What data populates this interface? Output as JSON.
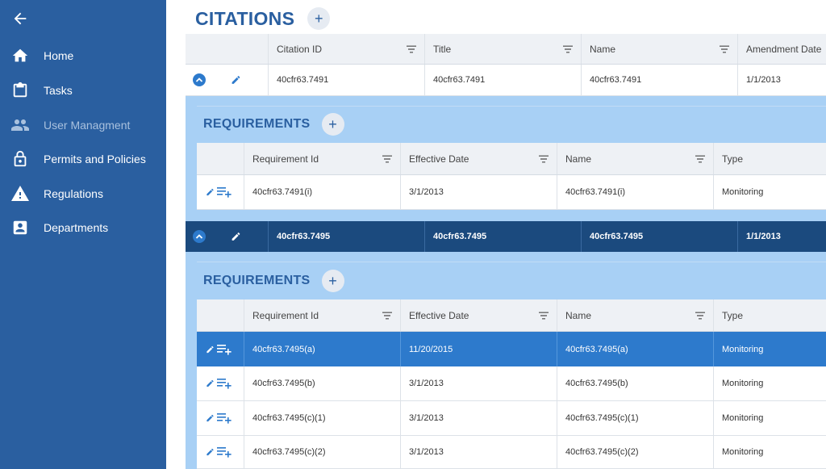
{
  "sidebar": {
    "items": [
      {
        "label": "Home",
        "icon": "home-icon"
      },
      {
        "label": "Tasks",
        "icon": "clipboard-icon"
      },
      {
        "label": "User Managment",
        "icon": "people-icon",
        "disabled": true
      },
      {
        "label": "Permits and Policies",
        "icon": "lock-icon"
      },
      {
        "label": "Regulations",
        "icon": "warning-icon"
      },
      {
        "label": "Departments",
        "icon": "contact-card-icon"
      }
    ]
  },
  "citations": {
    "title": "CITATIONS",
    "add_label": "+",
    "columns": [
      "Citation ID",
      "Title",
      "Name",
      "Amendment Date"
    ],
    "rows": [
      {
        "citation_id": "40cfr63.7491",
        "title": "40cfr63.7491",
        "name": "40cfr63.7491",
        "amendment_date": "1/1/2013"
      },
      {
        "citation_id": "40cfr63.7495",
        "title": "40cfr63.7495",
        "name": "40cfr63.7495",
        "amendment_date": "1/1/2013"
      }
    ]
  },
  "requirements": {
    "title": "REQUIREMENTS",
    "add_label": "+",
    "columns": [
      "Requirement Id",
      "Effective Date",
      "Name",
      "Type"
    ],
    "groups": [
      {
        "rows": [
          {
            "id": "40cfr63.7491(i)",
            "effective_date": "3/1/2013",
            "name": "40cfr63.7491(i)",
            "type": "Monitoring"
          }
        ]
      },
      {
        "rows": [
          {
            "id": "40cfr63.7495(a)",
            "effective_date": "11/20/2015",
            "name": "40cfr63.7495(a)",
            "type": "Monitoring"
          },
          {
            "id": "40cfr63.7495(b)",
            "effective_date": "3/1/2013",
            "name": "40cfr63.7495(b)",
            "type": "Monitoring"
          },
          {
            "id": "40cfr63.7495(c)(1)",
            "effective_date": "3/1/2013",
            "name": "40cfr63.7495(c)(1)",
            "type": "Monitoring"
          },
          {
            "id": "40cfr63.7495(c)(2)",
            "effective_date": "3/1/2013",
            "name": "40cfr63.7495(c)(2)",
            "type": "Monitoring"
          }
        ]
      }
    ]
  },
  "colors": {
    "sidebar": "#2a5fa0",
    "accent": "#2a5fa0",
    "selected_row": "#1b4a7e",
    "selected_req_row": "#2d7acc",
    "panel": "#a8d0f5"
  }
}
